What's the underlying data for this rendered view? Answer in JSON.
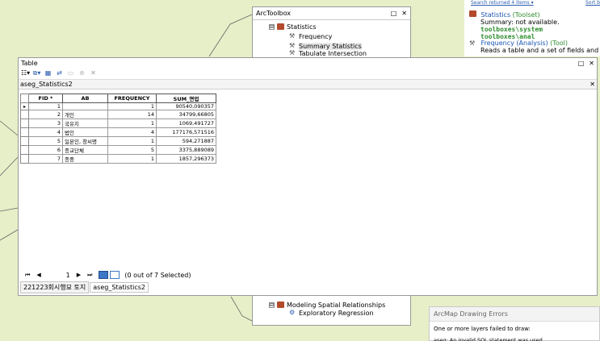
{
  "arctoolbox": {
    "title": "ArcToolbox",
    "tree_top": [
      {
        "label": "Statistics",
        "kind": "toolbox",
        "expander": "⊟"
      },
      {
        "label": "Frequency",
        "kind": "tool"
      },
      {
        "label": "Summary Statistics",
        "kind": "tool",
        "selected": true
      },
      {
        "label": "Tabulate Intersection",
        "kind": "tool"
      }
    ],
    "tree_bottom": [
      {
        "label": "Modeling Spatial Relationships",
        "kind": "toolbox",
        "expander": "⊟"
      },
      {
        "label": "Exploratory Regression",
        "kind": "tool"
      }
    ]
  },
  "search_panel": {
    "status": "Search returned 4 items ▾",
    "sort": "Sort b",
    "results": [
      {
        "name": "Statistics",
        "kind": "(Toolset)",
        "line2": "Summary: not available.",
        "line3": "toolboxes\\system toolboxes\\anal"
      },
      {
        "name": "Frequency (Analysis)",
        "kind": "(Tool)",
        "line2": "Reads a table and a set of fields and"
      }
    ]
  },
  "table_window": {
    "title": "Table",
    "table_name": "aseg_Statistics2",
    "columns": [
      "FID *",
      "AB",
      "FREQUENCY",
      "SUM_면업"
    ],
    "rows": [
      {
        "fid": "1",
        "ab": "",
        "freq": "1",
        "sum": "90540,090357",
        "current": true
      },
      {
        "fid": "2",
        "ab": "개인",
        "freq": "14",
        "sum": "34799,66805"
      },
      {
        "fid": "3",
        "ab": "국유지",
        "freq": "1",
        "sum": "1069,491727"
      },
      {
        "fid": "4",
        "ab": "법인",
        "freq": "4",
        "sum": "177176,571516"
      },
      {
        "fid": "5",
        "ab": "일본인, 창씨명",
        "freq": "1",
        "sum": "594,271887"
      },
      {
        "fid": "6",
        "ab": "종교단체",
        "freq": "5",
        "sum": "3375,889089"
      },
      {
        "fid": "7",
        "ab": "종중",
        "freq": "1",
        "sum": "1857,296373"
      }
    ],
    "nav": {
      "current_record": "1",
      "selection_status": "(0 out of 7 Selected)"
    },
    "tabs": [
      "221223회시행묘 토지",
      "aseg_Statistics2"
    ]
  },
  "error_dialog": {
    "title": "ArcMap Drawing Errors",
    "message": "One or more layers failed to draw:",
    "detail": "aseg: An invalid SQL statement was used."
  }
}
